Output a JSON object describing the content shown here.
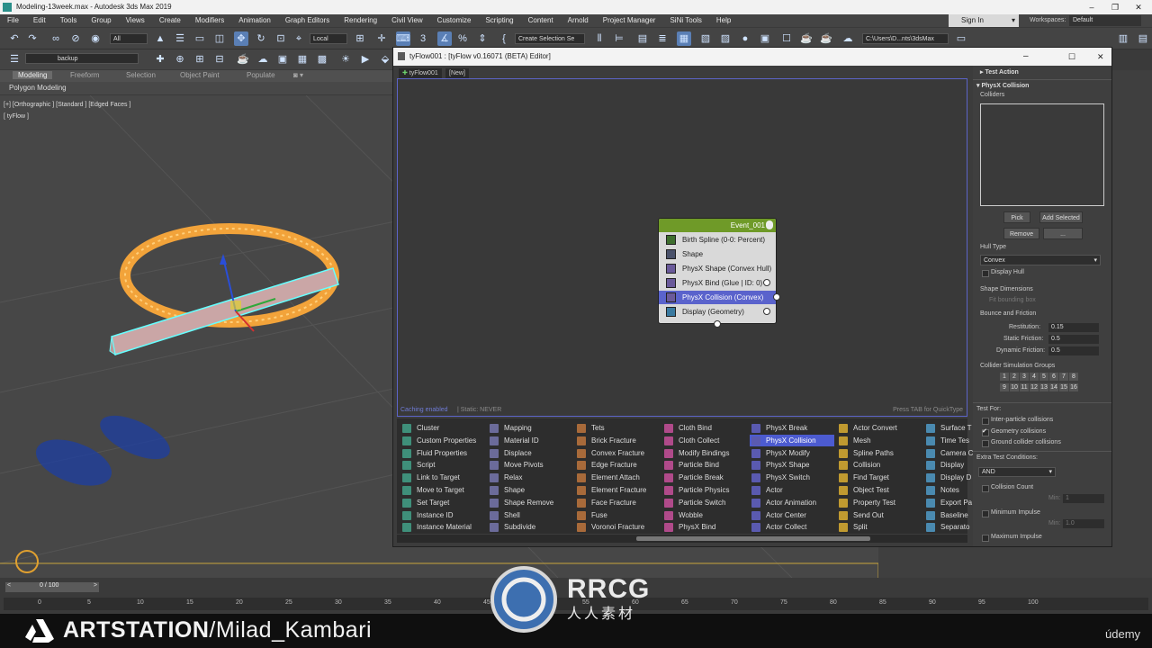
{
  "app": {
    "title": "Modeling-13week.max - Autodesk 3ds Max 2019",
    "min": "–",
    "max": "❐",
    "close": "✕"
  },
  "menu": [
    "File",
    "Edit",
    "Tools",
    "Group",
    "Views",
    "Create",
    "Modifiers",
    "Animation",
    "Graph Editors",
    "Rendering",
    "Civil View",
    "Customize",
    "Scripting",
    "Content",
    "Arnold",
    "Project Manager",
    "SiNi Tools",
    "Help"
  ],
  "signin": "Sign In",
  "workspaces": {
    "label": "Workspaces:",
    "value": "Default"
  },
  "toolbar": {
    "filter": "All",
    "coord": "Local",
    "selection_set": "Create Selection Se",
    "path": "C:\\Users\\D...nts\\3dsMax",
    "layer": "backup"
  },
  "ribbon_tabs": [
    "Modeling",
    "Freeform",
    "Selection",
    "Object Paint",
    "Populate"
  ],
  "polygon_modeling": "Polygon Modeling",
  "viewport": {
    "label1": "[+] [Orthographic ] [Standard ] [Edged Faces ]",
    "label2": "[ tyFlow ]"
  },
  "timeline": {
    "frame": "0 / 100",
    "ticks": [
      "0",
      "5",
      "10",
      "15",
      "20",
      "25",
      "30",
      "35",
      "40",
      "45",
      "50",
      "55",
      "60",
      "65",
      "70",
      "75",
      "80",
      "85",
      "90",
      "95",
      "100"
    ]
  },
  "banner": {
    "artstation": "ARTSTATION",
    "user": "/Milad_Kambari",
    "udemy": "údemy",
    "watermark": "RRCG",
    "watermark_cn": "人人素材"
  },
  "editor": {
    "title": "tyFlow001 : [tyFlow v0.16071 (BETA) Editor]",
    "tabs": [
      "tyFlow001",
      "[New]"
    ],
    "caching": "Caching enabled",
    "static": "| Static: NEVER",
    "quicktype": "Press TAB for QuickType",
    "node": {
      "title": "Event_001",
      "rows": [
        "Birth Spline (0-0: Percent)",
        "Shape",
        "PhysX Shape (Convex Hull)",
        "PhysX Bind (Glue | ID: 0)",
        "PhysX Collision (Convex)",
        "Display (Geometry)"
      ],
      "selected_index": 4
    },
    "palette": [
      [
        "Cluster",
        "Custom Properties",
        "Fluid Properties",
        "Script",
        "Link to Target",
        "Move to Target",
        "Set Target",
        "Instance ID",
        "Instance Material"
      ],
      [
        "Mapping",
        "Material ID",
        "Displace",
        "Move Pivots",
        "Relax",
        "Shape",
        "Shape Remove",
        "Shell",
        "Subdivide"
      ],
      [
        "Tets",
        "Brick Fracture",
        "Convex Fracture",
        "Edge Fracture",
        "Element Attach",
        "Element Fracture",
        "Face Fracture",
        "Fuse",
        "Voronoi Fracture"
      ],
      [
        "Cloth Bind",
        "Cloth Collect",
        "Modify Bindings",
        "Particle Bind",
        "Particle Break",
        "Particle Physics",
        "Particle Switch",
        "Wobble",
        "PhysX Bind"
      ],
      [
        "PhysX Break",
        "PhysX Collision",
        "PhysX Modify",
        "PhysX Shape",
        "PhysX Switch",
        "Actor",
        "Actor Animation",
        "Actor Center",
        "Actor Collect"
      ],
      [
        "Actor Convert",
        "Mesh",
        "Spline Paths",
        "Collision",
        "Find Target",
        "Object Test",
        "Property Test",
        "Send Out",
        "Split"
      ],
      [
        "Surface T",
        "Time Tes",
        "Camera C",
        "Display",
        "Display D",
        "Notes",
        "Export Pa",
        "Baseline",
        "Separato"
      ]
    ],
    "palette_colors": [
      "#3f8f7a",
      "#6b6b9a",
      "#a86a3a",
      "#b04a8a",
      "#5a5ab0",
      "#c09a30",
      "#4a8ab0"
    ],
    "palette_selected": "PhysX Collision"
  },
  "props": {
    "test_action": "Test Action",
    "header": "PhysX Collision",
    "colliders": "Colliders",
    "pick": "Pick",
    "add_selected": "Add Selected",
    "remove": "Remove",
    "dots": "...",
    "hull_type_label": "Hull Type",
    "hull_type": "Convex",
    "display_hull": "Display Hull",
    "shape_dims": "Shape Dimensions",
    "fit_bbox": "Fit bounding box",
    "bounce": "Bounce and Friction",
    "restitution_label": "Restitution:",
    "restitution": "0.15",
    "static_label": "Static Friction:",
    "static": "0.5",
    "dynamic_label": "Dynamic Friction:",
    "dynamic": "0.5",
    "groups_label": "Collider Simulation Groups",
    "groups": [
      "1",
      "2",
      "3",
      "4",
      "5",
      "6",
      "7",
      "8",
      "9",
      "10",
      "11",
      "12",
      "13",
      "14",
      "15",
      "16"
    ],
    "test_for": "Test For:",
    "inter": "Inter-particle collisions",
    "geom": "Geometry collisions",
    "ground": "Ground collider collisions",
    "extra": "Extra Test Conditions:",
    "and": "AND",
    "collision_count": "Collision Count",
    "min1": "Min:",
    "min1_val": "1",
    "min_impulse": "Minimum Impulse",
    "min2": "Min:",
    "min2_val": "1.0",
    "max_impulse": "Maximum Impulse"
  }
}
